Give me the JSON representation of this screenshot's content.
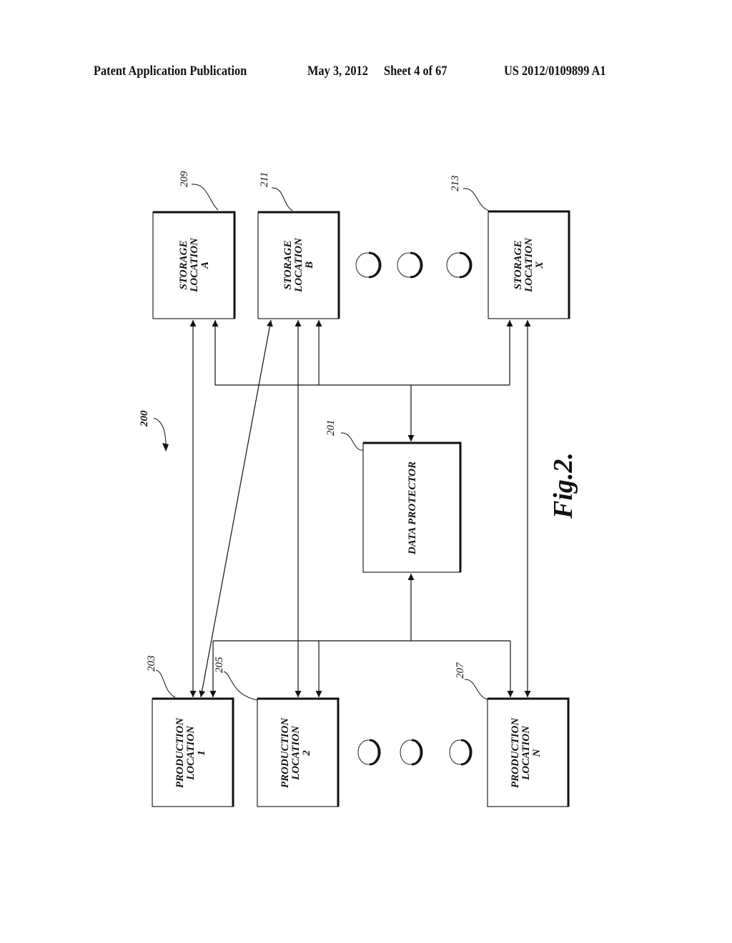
{
  "header": {
    "publication": "Patent Application Publication",
    "date": "May 3, 2012",
    "sheet": "Sheet 4 of 67",
    "number": "US 2012/0109899 A1"
  },
  "figure": {
    "label": "Fig.2.",
    "system_ref": "200",
    "data_protector": {
      "ref": "201",
      "lines": [
        "DATA PROTECTOR"
      ]
    },
    "storage_locations": [
      {
        "ref": "209",
        "lines": [
          "STORAGE",
          "LOCATION",
          "A"
        ]
      },
      {
        "ref": "211",
        "lines": [
          "STORAGE",
          "LOCATION",
          "B"
        ]
      },
      {
        "ref": "213",
        "lines": [
          "STORAGE",
          "LOCATION",
          "X"
        ]
      }
    ],
    "production_locations": [
      {
        "ref": "203",
        "lines": [
          "PRODUCTION",
          "LOCATION",
          "1"
        ]
      },
      {
        "ref": "205",
        "lines": [
          "PRODUCTION",
          "LOCATION",
          "2"
        ]
      },
      {
        "ref": "207",
        "lines": [
          "PRODUCTION",
          "LOCATION",
          "N"
        ]
      }
    ],
    "ellipsis_count": 3
  }
}
